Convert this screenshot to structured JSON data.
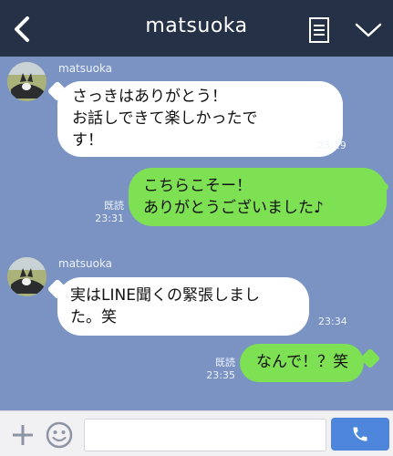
{
  "header": {
    "title": "matsuoka"
  },
  "messages": [
    {
      "sender": "matsuoka",
      "text": "さっきはありがとう！\nお話しできて楽しかったで\nす！",
      "time": "23:19"
    },
    {
      "read": "既読",
      "time": "23:31",
      "text": "こちらこそー！\nありがとうございました♪"
    },
    {
      "sender": "matsuoka",
      "text": "実はLINE聞くの緊張しまし\nた。笑",
      "time": "23:34"
    },
    {
      "read": "既読",
      "time": "23:35",
      "text": "なんで！？笑"
    }
  ],
  "input": {
    "value": ""
  },
  "colors": {
    "header_bg": "#253146",
    "chat_bg": "#7a93c3",
    "incoming_bubble": "#ffffff",
    "outgoing_bubble": "#7ee053",
    "send_button": "#4d86db"
  },
  "icons": {
    "back": "chevron-left-icon",
    "notes": "notes-icon",
    "more": "chevron-down-icon",
    "plus": "plus-icon",
    "emoji": "smiley-icon",
    "send": "phone-icon"
  }
}
